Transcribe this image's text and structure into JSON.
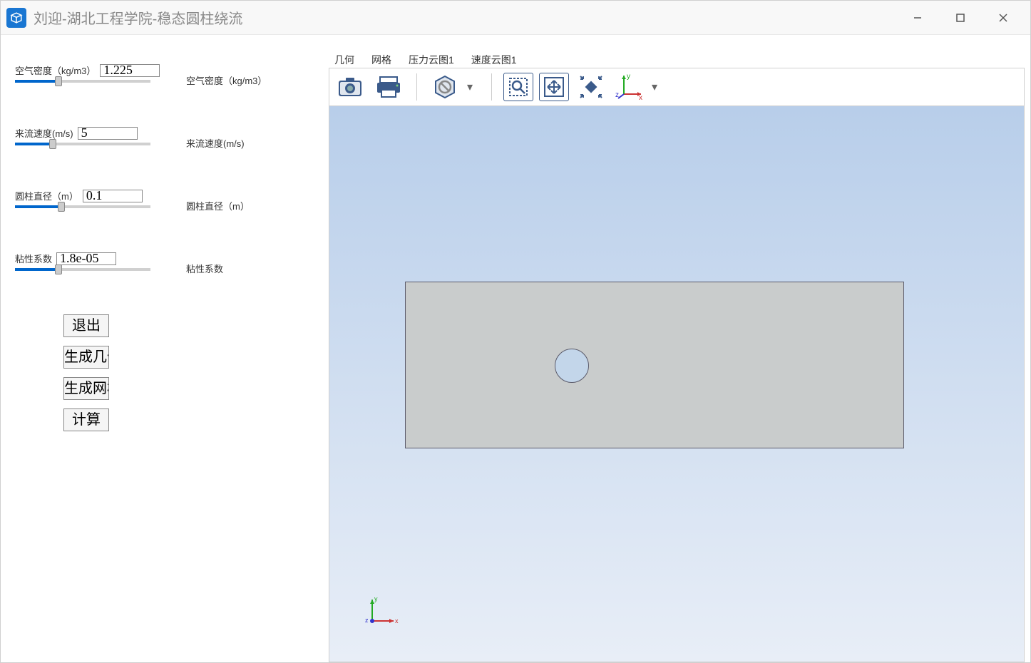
{
  "window": {
    "title": "刘迎-湖北工程学院-稳态圆柱绕流"
  },
  "params": {
    "density": {
      "label": "空气密度（kg/m3）",
      "value": "1.225",
      "rightLabel": "空气密度（kg/m3）",
      "sliderPct": 32
    },
    "velocity": {
      "label": "来流速度(m/s)",
      "value": "5",
      "rightLabel": "来流速度(m/s)",
      "sliderPct": 28
    },
    "diameter": {
      "label": "圆柱直径（m）",
      "value": "0.1",
      "rightLabel": "圆柱直径（m）",
      "sliderPct": 34
    },
    "viscosity": {
      "label": "粘性系数",
      "value": "1.8e-05",
      "rightLabel": "粘性系数",
      "sliderPct": 32
    }
  },
  "buttons": {
    "exit": "退出",
    "genGeom": "生成几何",
    "genMesh": "生成网格",
    "compute": "计算"
  },
  "tabs": {
    "geom": "几何",
    "mesh": "网格",
    "pressure": "压力云图1",
    "velocity": "速度云图1"
  },
  "axes": {
    "x": "x",
    "y": "y",
    "z": "z"
  }
}
